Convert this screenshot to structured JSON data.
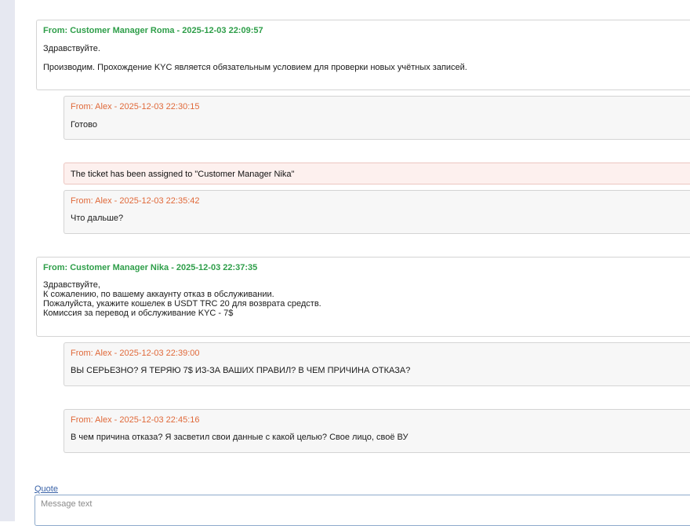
{
  "messages": [
    {
      "header": "From: Customer Manager Roma - 2025-12-03 22:09:57",
      "lines": [
        "Здравствуйте.",
        "Производим. Прохождение KYC является обязательным условием для проверки новых учётных записей."
      ]
    },
    {
      "header": "From: Alex - 2025-12-03 22:30:15",
      "lines": [
        "Готово"
      ]
    },
    {
      "system": "The ticket has been assigned to \"Customer Manager Nika\""
    },
    {
      "header": "From: Alex - 2025-12-03 22:35:42",
      "lines": [
        "Что дальше?"
      ]
    },
    {
      "header": "From: Customer Manager Nika - 2025-12-03 22:37:35",
      "lines": [
        "Здравствуйте,",
        "К сожалению, по вашему аккаунту отказ в обслуживании.",
        "Пожалуйста, укажите кошелек в USDT TRC 20 для возврата средств.",
        "Комиссия за перевод и обслуживание KYC - 7$"
      ]
    },
    {
      "header": "From: Alex - 2025-12-03 22:39:00",
      "lines": [
        "ВЫ СЕРЬЕЗНО? Я ТЕРЯЮ 7$ ИЗ-ЗА ВАШИХ ПРАВИЛ? В ЧЕМ ПРИЧИНА ОТКАЗА?"
      ]
    },
    {
      "header": "From: Alex - 2025-12-03 22:45:16",
      "lines": [
        "В чем причина отказа? Я засветил свои данные с какой целью? Свое лицо, своё ВУ"
      ]
    }
  ],
  "reply": {
    "quote_label": "Quote",
    "placeholder": "Message text"
  }
}
